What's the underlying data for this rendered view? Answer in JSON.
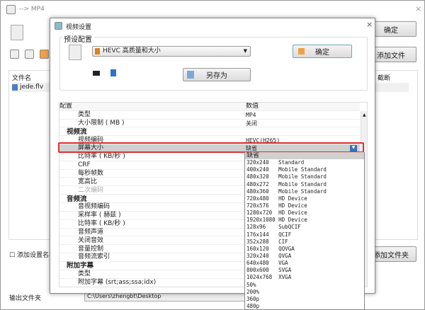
{
  "window": {
    "title": "--> MP4",
    "ok_label": "确定",
    "add_file_label": "添加文件",
    "add_folder_label": "添加文件夹",
    "file_col": "文件名",
    "right_col": "截断",
    "files": [
      "jede.flv"
    ],
    "add_setting_name_label": "添加设置名称",
    "output_folder_label": "输出文件夹",
    "output_folder_value": "C:\\Users\\zhengbt\\Desktop"
  },
  "dialog": {
    "title": "视频设置",
    "preset_group": "预设配置",
    "preset_value": "HEVC 高质量和大小",
    "ok_label": "确定",
    "save_as_label": "另存为",
    "grid_header": {
      "key": "配置",
      "value": "数值"
    },
    "rows": [
      {
        "k": "类型",
        "v": "MP4"
      },
      {
        "k": "大小限制 ( MB )",
        "v": "关闭"
      },
      {
        "k": "视频流",
        "cat": true
      },
      {
        "k": "视频编码",
        "v": "HEVC(H265)"
      },
      {
        "k": "屏幕大小",
        "v": "缺省",
        "sel": true
      },
      {
        "k": "比特率 ( KB/秒 )"
      },
      {
        "k": "CRF"
      },
      {
        "k": "每秒帧数"
      },
      {
        "k": "宽高比"
      },
      {
        "k": "二次编码",
        "dim": true
      },
      {
        "k": "音频流",
        "cat": true
      },
      {
        "k": "音视频编码"
      },
      {
        "k": "采样率 ( 赫兹 )"
      },
      {
        "k": "比特率 ( KB/秒 )"
      },
      {
        "k": "音频声道"
      },
      {
        "k": "关闭音效"
      },
      {
        "k": "音量控制"
      },
      {
        "k": "音频流索引"
      },
      {
        "k": "附加字幕",
        "cat": true
      },
      {
        "k": "类型"
      },
      {
        "k": "附加字幕 (srt;ass;ssa;idx)"
      }
    ],
    "dropdown_options": [
      "缺省",
      "320x240   Standard",
      "400x240   Mobile Standard",
      "480x320   Mobile Standard",
      "480x272   Mobile Standard",
      "480x360   Mobile Standard",
      "720x480   HD Device",
      "720x576   HD Device",
      "1280x720  HD Device",
      "1920x1080 HD Device",
      "128x96    SubQCIF",
      "176x144   QCIF",
      "352x288   CIF",
      "160x120   QQVGA",
      "320x240   QVGA",
      "640x480   VGA",
      "800x600   SVGA",
      "1024x768  XVGA",
      "50%",
      "200%",
      "360p",
      "480p"
    ]
  },
  "colors": {
    "highlight": "#e03030",
    "selected_row": "#d0d0d0"
  }
}
